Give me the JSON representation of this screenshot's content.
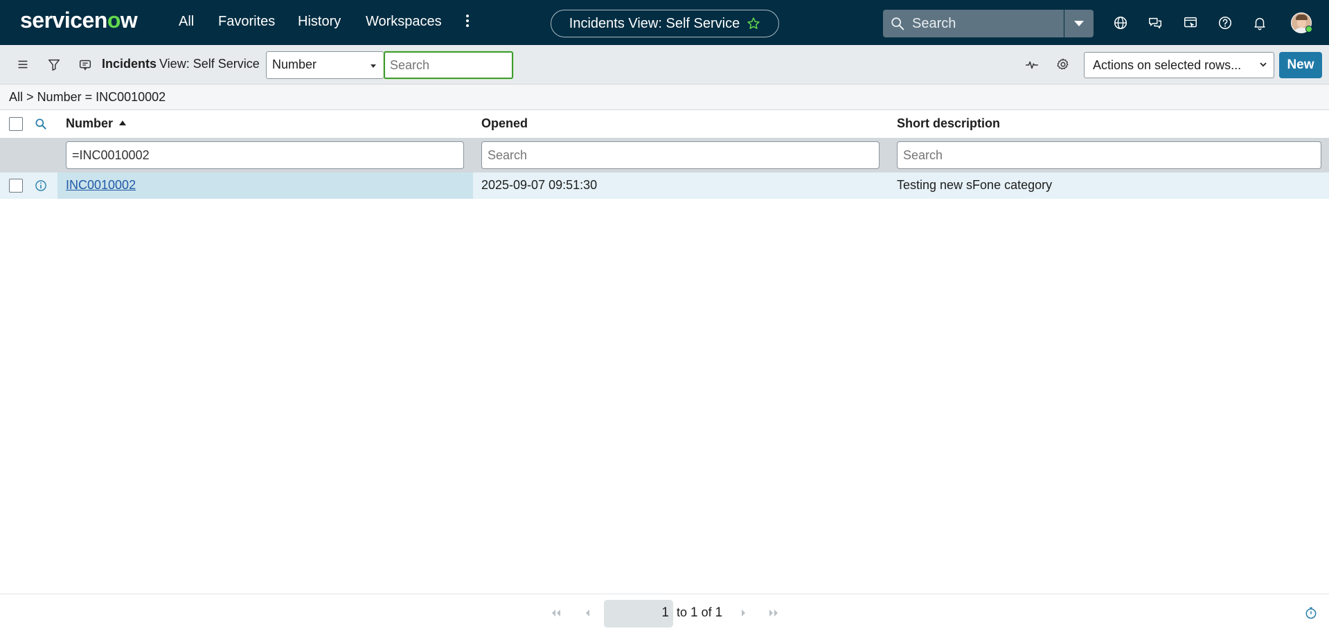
{
  "header": {
    "logo_text": "servicenow",
    "nav": [
      {
        "label": "All"
      },
      {
        "label": "Favorites"
      },
      {
        "label": "History"
      },
      {
        "label": "Workspaces"
      }
    ],
    "context_title": "Incidents View: Self Service",
    "search_placeholder": "Search",
    "icons": [
      "globe-icon",
      "chat-icon",
      "screen-share-icon",
      "help-icon",
      "bell-icon"
    ]
  },
  "toolbar": {
    "list_title": "Incidents",
    "view_label": "View: Self Service",
    "field_select_value": "Number",
    "search_placeholder": "Search",
    "actions_select_value": "Actions on selected rows...",
    "new_label": "New"
  },
  "breadcrumb": {
    "root": "All",
    "separator": ">",
    "condition": "Number = INC0010002"
  },
  "table": {
    "columns": [
      {
        "label": "Number",
        "sorted": "ascending"
      },
      {
        "label": "Opened"
      },
      {
        "label": "Short description"
      }
    ],
    "filters": {
      "number": "=INC0010002",
      "opened_placeholder": "Search",
      "short_description_placeholder": "Search"
    },
    "rows": [
      {
        "number": "INC0010002",
        "opened": "2025-09-07 09:51:30",
        "short_description": "Testing new sFone category"
      }
    ]
  },
  "pagination": {
    "current_first": "1",
    "to_label": "to",
    "current_last": "1",
    "of_label": "of",
    "total": "1"
  },
  "colors": {
    "header_bg": "#032d42",
    "accent_green": "#62d84e",
    "primary_button": "#1f79a7",
    "link": "#1f5aa6"
  }
}
